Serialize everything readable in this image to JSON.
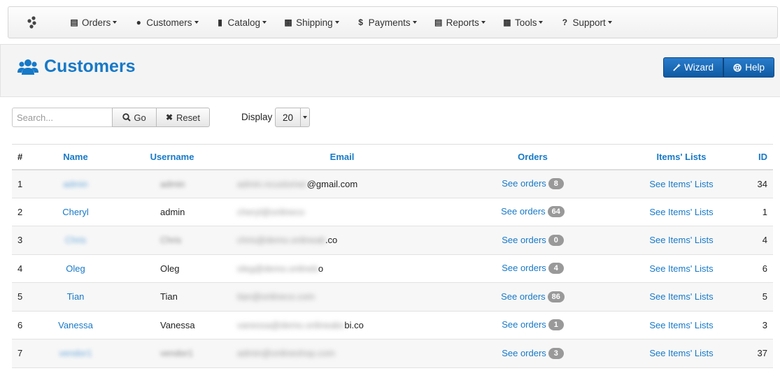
{
  "nav": {
    "logo_icon": "brand-logo-icon",
    "items": [
      {
        "label": "Orders",
        "icon": "money-icon"
      },
      {
        "label": "Customers",
        "icon": "users-icon"
      },
      {
        "label": "Catalog",
        "icon": "bookmark-icon"
      },
      {
        "label": "Shipping",
        "icon": "truck-icon"
      },
      {
        "label": "Payments",
        "icon": "dollar-icon"
      },
      {
        "label": "Reports",
        "icon": "money-icon"
      },
      {
        "label": "Tools",
        "icon": "table-icon"
      },
      {
        "label": "Support",
        "icon": "question-icon"
      }
    ]
  },
  "header": {
    "title": "Customers",
    "wizard_label": "Wizard",
    "help_label": "Help",
    "accent": "#1779c7"
  },
  "toolbar": {
    "search_placeholder": "Search...",
    "go_label": "Go",
    "reset_label": "Reset",
    "display_label": "Display",
    "display_value": "20"
  },
  "table": {
    "columns": [
      "#",
      "Name",
      "Username",
      "Email",
      "Orders",
      "Items' Lists",
      "ID"
    ],
    "orders_link": "See orders",
    "lists_link": "See Items' Lists",
    "rows": [
      {
        "num": "1",
        "name": "admin",
        "username": "admin",
        "email_blur": "admin.ncustomer",
        "email_tail": "@gmail.com",
        "orders": "8",
        "id": "34",
        "name_blurred": true,
        "user_blurred": true
      },
      {
        "num": "2",
        "name": "Cheryl",
        "username": "admin",
        "email_blur": "cheryl@onlineco",
        "email_tail": "",
        "orders": "64",
        "id": "1",
        "name_blurred": false,
        "user_blurred": false
      },
      {
        "num": "3",
        "name": "Chris",
        "username": "Chris",
        "email_blur": "chris@demo.onlineab",
        "email_tail": ".co",
        "orders": "0",
        "id": "4",
        "name_blurred": true,
        "user_blurred": true
      },
      {
        "num": "4",
        "name": "Oleg",
        "username": "Oleg",
        "email_blur": "oleg@demo.onlineb",
        "email_tail": "o",
        "orders": "4",
        "id": "6",
        "name_blurred": false,
        "user_blurred": false
      },
      {
        "num": "5",
        "name": "Tian",
        "username": "Tian",
        "email_blur": "tian@onlineco.com",
        "email_tail": "",
        "orders": "86",
        "id": "5",
        "name_blurred": false,
        "user_blurred": false
      },
      {
        "num": "6",
        "name": "Vanessa",
        "username": "Vanessa",
        "email_blur": "vanessa@demo.onlineabc",
        "email_tail": "bi.co",
        "orders": "1",
        "id": "3",
        "name_blurred": false,
        "user_blurred": false
      },
      {
        "num": "7",
        "name": "vendor1",
        "username": "vendor1",
        "email_blur": "admin@onlineshop.com",
        "email_tail": "",
        "orders": "3",
        "id": "37",
        "name_blurred": true,
        "user_blurred": true
      }
    ]
  }
}
